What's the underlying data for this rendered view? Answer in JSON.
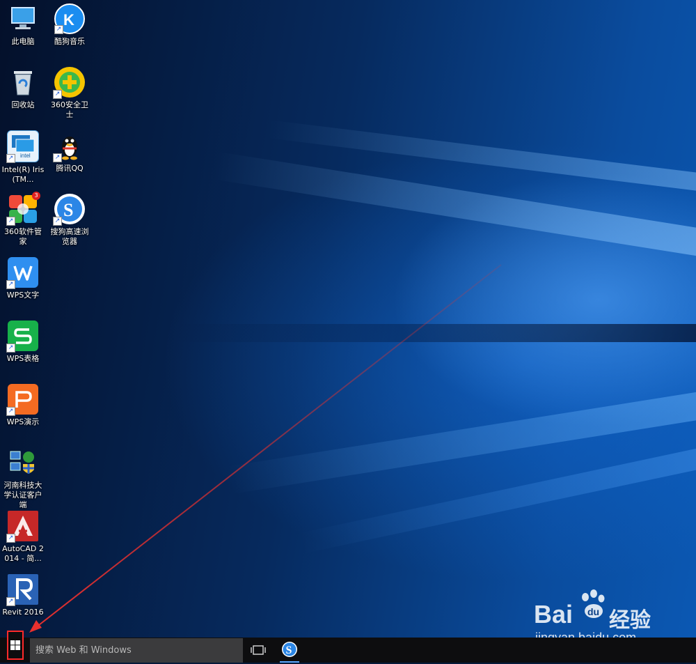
{
  "desktop": {
    "icons": [
      {
        "label": "此电脑",
        "icon": "computer-icon"
      },
      {
        "label": "酷狗音乐",
        "icon": "kugou-icon"
      },
      {
        "label": "回收站",
        "icon": "recycle-bin-icon"
      },
      {
        "label": "360安全卫士",
        "icon": "360-safe-icon"
      },
      {
        "label": "Intel(R) Iris(TM...",
        "icon": "intel-graphics-icon"
      },
      {
        "label": "腾讯QQ",
        "icon": "qq-penguin-icon"
      },
      {
        "label": "360软件管家",
        "icon": "360-software-manager-icon",
        "badge": "3"
      },
      {
        "label": "搜狗高速浏览器",
        "icon": "sogou-browser-icon"
      },
      {
        "label": "WPS文字",
        "icon": "wps-writer-icon"
      },
      {
        "label": "WPS表格",
        "icon": "wps-spreadsheet-icon"
      },
      {
        "label": "WPS演示",
        "icon": "wps-presentation-icon"
      },
      {
        "label": "河南科技大学认证客户端",
        "icon": "network-auth-client-icon"
      },
      {
        "label": "AutoCAD 2014 - 简...",
        "icon": "autocad-icon"
      },
      {
        "label": "Revit 2016",
        "icon": "revit-icon"
      }
    ]
  },
  "taskbar": {
    "start_icon": "windows-logo-icon",
    "search_placeholder": "搜索 Web 和 Windows",
    "taskview_icon": "task-view-icon",
    "pinned_app_icon": "sogou-browser-icon"
  },
  "watermark": {
    "brand": "Bai",
    "brand_cn": "经验",
    "url": "jingyan.baidu.com"
  },
  "colors": {
    "annotation_red": "#e8302e",
    "taskbar_bg": "#0d0d0f",
    "search_bg": "#3b3b3d"
  }
}
